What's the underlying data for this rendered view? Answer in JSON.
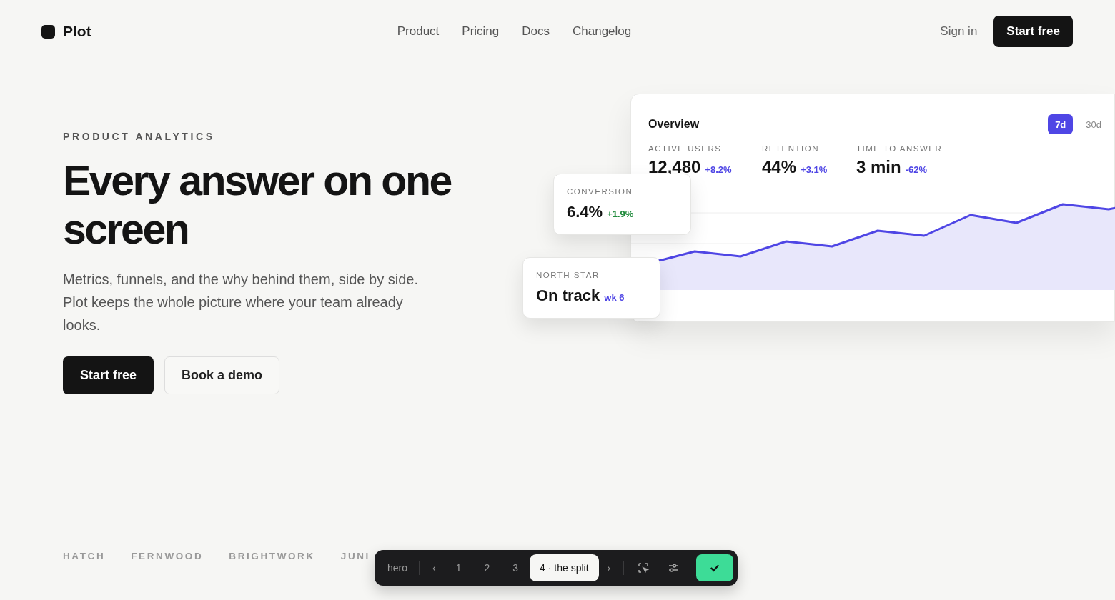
{
  "brand": {
    "name": "Plot"
  },
  "nav": [
    "Product",
    "Pricing",
    "Docs",
    "Changelog"
  ],
  "header_actions": {
    "sign_in": "Sign in",
    "cta": "Start free"
  },
  "hero": {
    "eyebrow": "PRODUCT ANALYTICS",
    "title": "Every answer on one screen",
    "body": "Metrics, funnels, and the why behind them, side by side. Plot keeps the whole picture where your team already looks.",
    "buttons": [
      {
        "label": "Start free",
        "kind": "primary"
      },
      {
        "label": "Book a demo",
        "kind": "secondary"
      }
    ]
  },
  "dashboard": {
    "title": "Overview",
    "ranges": [
      {
        "label": "7d",
        "selected": true
      },
      {
        "label": "30d",
        "selected": false
      }
    ],
    "metrics": [
      {
        "label": "ACTIVE USERS",
        "value": "12,480",
        "delta": "+8.2%"
      },
      {
        "label": "RETENTION",
        "value": "44%",
        "delta": "+3.1%"
      },
      {
        "label": "TIME TO ANSWER",
        "value": "3 min",
        "delta": "-62%"
      }
    ]
  },
  "floating_cards": [
    {
      "label": "CONVERSION",
      "value": "6.4%",
      "delta": "+1.9%",
      "color": "#1f8a3b"
    },
    {
      "label": "NORTH STAR",
      "value": "On track",
      "delta": "wk 6",
      "color": "#4f46e5"
    }
  ],
  "logos": [
    "HATCH",
    "FERNWOOD",
    "BRIGHTWORK",
    "JUNI"
  ],
  "toolbar": {
    "section": "hero",
    "prev": "‹",
    "next": "›",
    "pages": [
      {
        "label": "1",
        "selected": false
      },
      {
        "label": "2",
        "selected": false
      },
      {
        "label": "3",
        "selected": false
      },
      {
        "label": "4 · the split",
        "selected": true
      }
    ]
  }
}
